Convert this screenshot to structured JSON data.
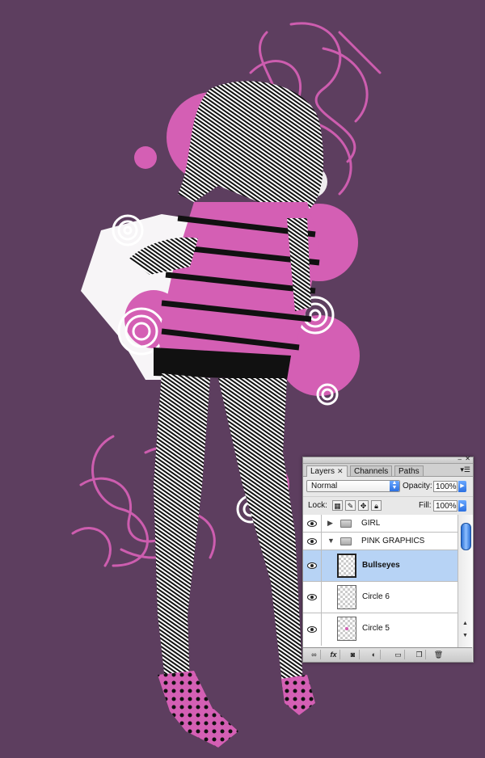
{
  "colors": {
    "background": "#5d3e5f",
    "accent_pink": "#d45fb4",
    "selected_row": "#b7d3f5"
  },
  "layers_panel": {
    "tabs": [
      {
        "label": "Layers",
        "active": true
      },
      {
        "label": "Channels",
        "active": false
      },
      {
        "label": "Paths",
        "active": false
      }
    ],
    "blend_mode": "Normal",
    "opacity_label": "Opacity:",
    "opacity_value": "100%",
    "lock_label": "Lock:",
    "fill_label": "Fill:",
    "fill_value": "100%",
    "layers": [
      {
        "name": "GIRL",
        "kind": "group",
        "expanded": false,
        "visible": true
      },
      {
        "name": "PINK GRAPHICS",
        "kind": "group",
        "expanded": true,
        "visible": true
      },
      {
        "name": "Bullseyes",
        "kind": "layer",
        "selected": true,
        "visible": true
      },
      {
        "name": "Circle 6",
        "kind": "layer",
        "selected": false,
        "visible": true
      },
      {
        "name": "Circle 5",
        "kind": "layer",
        "selected": false,
        "visible": true
      }
    ],
    "bottom_icons": [
      "link-icon",
      "fx-icon",
      "mask-icon",
      "adjustment-icon",
      "folder-icon",
      "new-layer-icon",
      "trash-icon"
    ]
  }
}
